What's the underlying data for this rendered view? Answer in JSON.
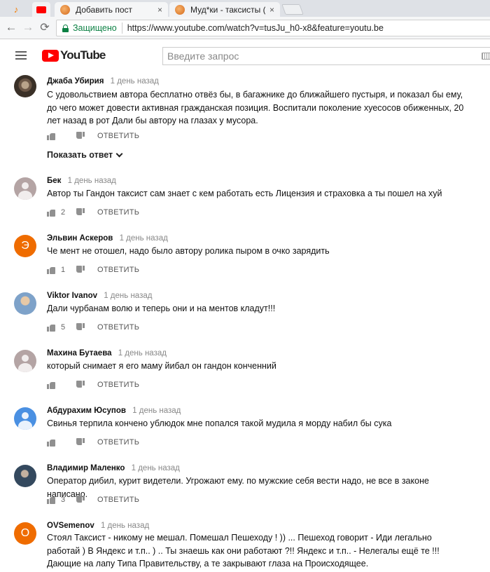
{
  "browser": {
    "tabs": [
      {
        "title": "Добавить пост",
        "active": false
      },
      {
        "title": "Муд*ки - таксисты (бомбит)",
        "active": true
      }
    ],
    "tab_close": "×",
    "security_label": "Защищено",
    "url": "https://www.youtube.com/watch?v=tusJu_h0-x8&feature=youtu.be",
    "back": "←",
    "forward": "→",
    "reload": "⟳"
  },
  "youtube": {
    "logo_text": "YouTube",
    "search_placeholder": "Введите запрос",
    "colors": {
      "brand": "#ff0000",
      "secure": "#0b8043"
    }
  },
  "comments": [
    {
      "author": "Джаба Убирия",
      "time": "1 день назад",
      "avatar": "photo",
      "text": "С удовольствием автора бесплатно отвёз бы, в багажнике до ближайшего пустыря, и показал бы ему, до чего может довести активная гражданская позиция. Воспитали поколение хуесосов обиженных, 20 лет назад в рот Дали бы автору на глазах у мусора.",
      "likes": "",
      "reply_label": "ОТВЕТИТЬ",
      "show_replies": "Показать ответ"
    },
    {
      "author": "Бек",
      "time": "1 день назад",
      "avatar": "default",
      "text": "Автор ты Гандон таксист сам знает с  кем работать есть Лицензия и страховка а ты пошел на хуй",
      "likes": "2",
      "reply_label": "ОТВЕТИТЬ"
    },
    {
      "author": "Эльвин Аскеров",
      "time": "1 день назад",
      "avatar": "letter",
      "avatar_letter": "Э",
      "text": "Че мент не отошел, надо было автору ролика пыром в очко зарядить",
      "likes": "1",
      "reply_label": "ОТВЕТИТЬ"
    },
    {
      "author": "Viktor Ivanov",
      "time": "1 день назад",
      "avatar": "photo",
      "text": "Дали чурбанам волю и теперь они и на ментов кладут!!!",
      "likes": "5",
      "reply_label": "ОТВЕТИТЬ"
    },
    {
      "author": "Махина Бутаева",
      "time": "1 день назад",
      "avatar": "default",
      "text": "который снимает я его маму йибал он гандон конченний",
      "likes": "",
      "reply_label": "ОТВЕТИТЬ"
    },
    {
      "author": "Абдурахим Юсупов",
      "time": "1 день назад",
      "avatar": "default-blue",
      "text": "Свинья терпила кончено ублюдок мне попался такой мудила я морду набил бы сука",
      "likes": "",
      "reply_label": "ОТВЕТИТЬ"
    },
    {
      "author": "Владимир Маленко",
      "time": "1 день назад",
      "avatar": "photo",
      "text": "Оператор дибил, курит видетели. Угрожают ему. по мужские себя вести надо, не все в законе написано.",
      "likes": "3",
      "reply_label": "ОТВЕТИТЬ"
    },
    {
      "author": "OVSemenov",
      "time": "1 день назад",
      "avatar": "letter",
      "avatar_letter": "O",
      "text": "Стоял Таксист - никому не мешал. Помешал Пешеходу ! )) ... Пешеход говорит - Иди легально работай ) В Яндекс и т.п.. ) .. Ты знаешь как они работают ?!! Яндекс и т.п.. - Нелегалы ещё те !!! Дающие на лапу Типа Правительству, а те закрывают глаза на Происходящее.",
      "likes": "",
      "reply_label": ""
    }
  ]
}
